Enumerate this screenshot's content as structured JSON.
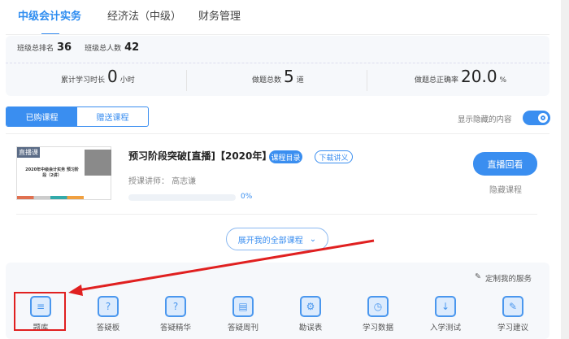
{
  "tabs": [
    "中级会计实务",
    "经济法（中级）",
    "财务管理"
  ],
  "stats": {
    "rank_label": "班级总排名",
    "rank": "36",
    "total_label": "班级总人数",
    "total": "42",
    "study_label": "累计学习时长",
    "study": "0",
    "study_unit": "小时",
    "q_label": "做题总数",
    "q": "5",
    "q_unit": "道",
    "acc_label": "做题总正确率",
    "acc": "20.0",
    "acc_unit": "%"
  },
  "course_tabs": [
    "已购课程",
    "赠送课程"
  ],
  "show_hidden": "显示隐藏的内容",
  "course": {
    "badge": "直播课",
    "thumb_title": "2020年中级会计实务 预习阶段（2讲）",
    "title": "预习阶段突破[直播]【2020年】",
    "tag1": "课程目录",
    "tag2": "下载讲义",
    "teacher": "授课讲师： 高志谦",
    "progress_label": "0%",
    "progress": 0,
    "play": "直播回看",
    "hide": "隐藏课程"
  },
  "expand": "展开我的全部课程",
  "custom": "定制我的服务",
  "services": [
    {
      "label": "题库",
      "icon": "≡"
    },
    {
      "label": "答疑板",
      "icon": "?"
    },
    {
      "label": "答疑精华",
      "icon": "?"
    },
    {
      "label": "答疑周刊",
      "icon": "▤"
    },
    {
      "label": "勘误表",
      "icon": "⚙"
    },
    {
      "label": "学习数据",
      "icon": "◷"
    },
    {
      "label": "入学测试",
      "icon": "↓"
    },
    {
      "label": "学习建议",
      "icon": "✎"
    }
  ],
  "colors": {
    "accent": "#3a8ef0",
    "annotation": "#e02020"
  }
}
